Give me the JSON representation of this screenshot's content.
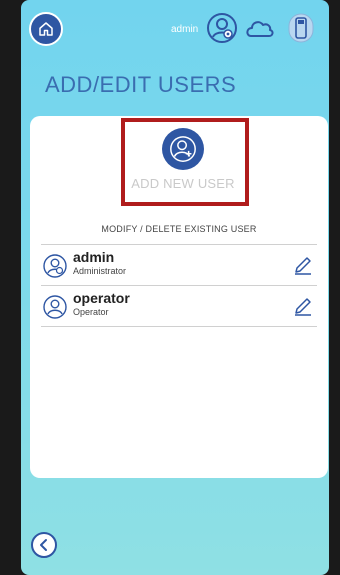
{
  "header": {
    "current_user": "admin",
    "icons": [
      "home-icon",
      "user-settings-icon",
      "cloud-icon",
      "usb-drive-icon"
    ]
  },
  "page": {
    "title": "ADD/EDIT USERS"
  },
  "add_user": {
    "label": "ADD NEW USER",
    "icon": "add-user-icon"
  },
  "existing": {
    "section_title": "MODIFY / DELETE EXISTING USER",
    "users": [
      {
        "name": "admin",
        "role": "Administrator"
      },
      {
        "name": "operator",
        "role": "Operator"
      }
    ]
  },
  "colors": {
    "accent": "#2e56a3",
    "title": "#3a6db0",
    "highlight": "#b01c1c",
    "background_top": "#72d4ee"
  }
}
